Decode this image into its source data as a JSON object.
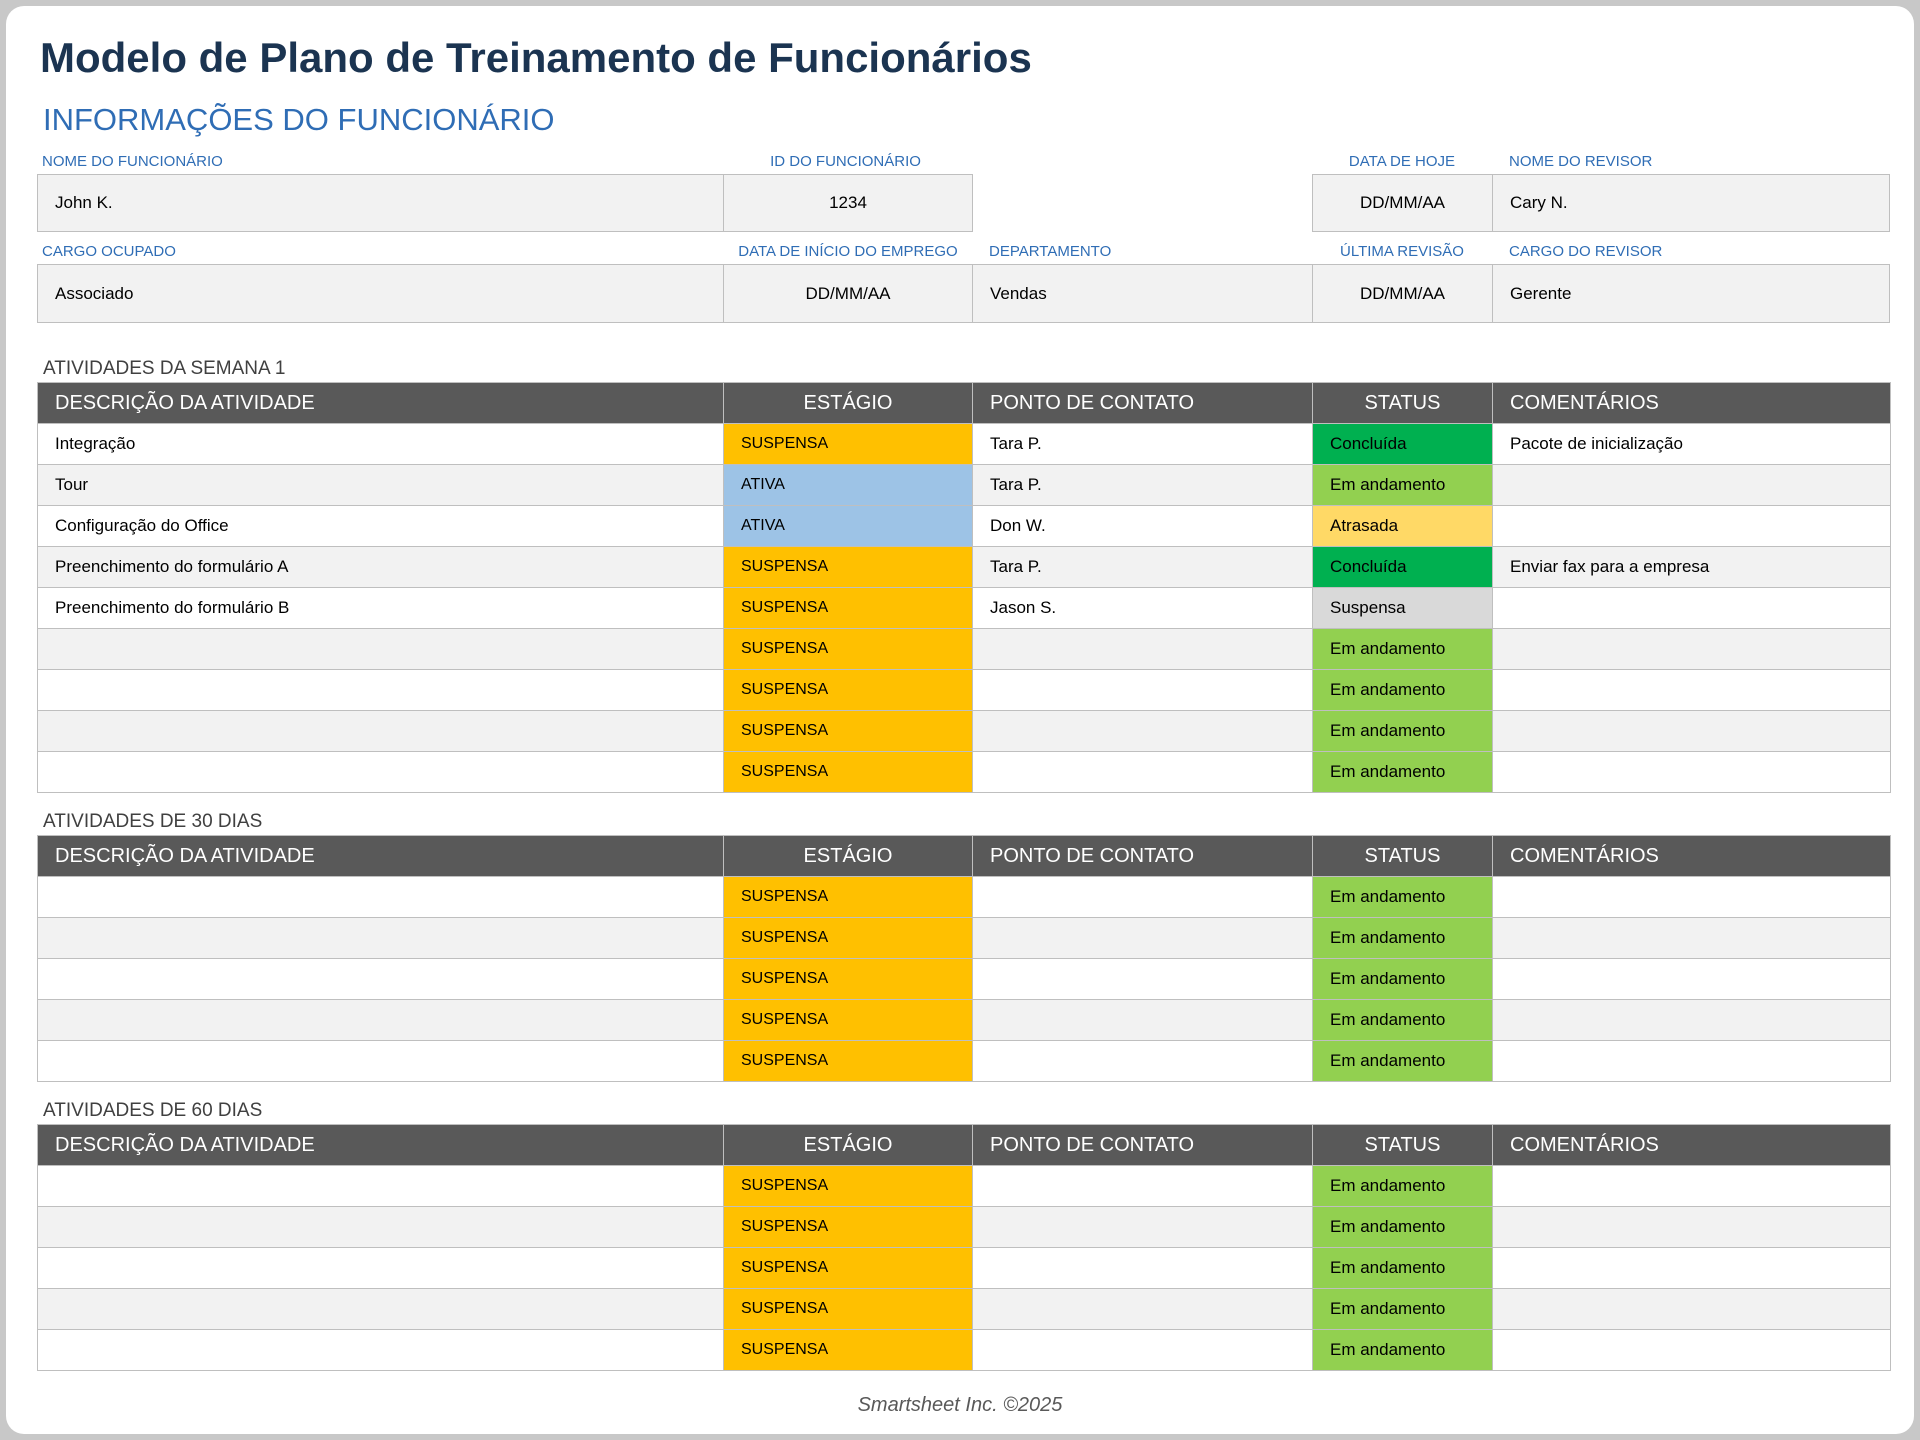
{
  "title": "Modelo de Plano de Treinamento de Funcionários",
  "info_heading": "INFORMAÇÕES DO FUNCIONÁRIO",
  "info": {
    "employee_name_label": "NOME DO FUNCIONÁRIO",
    "employee_name": "John K.",
    "employee_id_label": "ID DO FUNCIONÁRIO",
    "employee_id": "1234",
    "today_label": "DATA DE HOJE",
    "today": "DD/MM/AA",
    "reviewer_name_label": "NOME DO REVISOR",
    "reviewer_name": "Cary N.",
    "position_label": "CARGO OCUPADO",
    "position": "Associado",
    "start_date_label": "DATA DE INÍCIO DO EMPREGO",
    "start_date": "DD/MM/AA",
    "department_label": "DEPARTAMENTO",
    "department": "Vendas",
    "last_review_label": "ÚLTIMA REVISÃO",
    "last_review": "DD/MM/AA",
    "reviewer_position_label": "CARGO DO REVISOR",
    "reviewer_position": "Gerente"
  },
  "columns": {
    "description": "DESCRIÇÃO DA ATIVIDADE",
    "stage": "ESTÁGIO",
    "contact": "PONTO DE CONTATO",
    "status": "STATUS",
    "comments": "COMENTÁRIOS"
  },
  "colors": {
    "stage_suspensa": "#ffc000",
    "stage_ativa": "#9dc3e6",
    "status_em_andamento": "#92d050",
    "status_concluida": "#00b050",
    "status_atrasada": "#ffd966",
    "status_suspensa": "#d9d9d9",
    "header_bg": "#595959",
    "title_color": "#1b3451",
    "accent_blue": "#2f6db5"
  },
  "tables": [
    {
      "title": "ATIVIDADES DA SEMANA 1",
      "rows": [
        {
          "description": "Integração",
          "stage": "SUSPENSA",
          "contact": "Tara P.",
          "status": "Concluída",
          "comments": "Pacote de inicialização"
        },
        {
          "description": "Tour",
          "stage": "ATIVA",
          "contact": "Tara P.",
          "status": "Em andamento",
          "comments": ""
        },
        {
          "description": "Configuração do Office",
          "stage": "ATIVA",
          "contact": "Don W.",
          "status": "Atrasada",
          "comments": ""
        },
        {
          "description": "Preenchimento do formulário A",
          "stage": "SUSPENSA",
          "contact": "Tara P.",
          "status": "Concluída",
          "comments": "Enviar fax para a empresa"
        },
        {
          "description": "Preenchimento do formulário B",
          "stage": "SUSPENSA",
          "contact": "Jason S.",
          "status": "Suspensa",
          "comments": ""
        },
        {
          "description": "",
          "stage": "SUSPENSA",
          "contact": "",
          "status": "Em andamento",
          "comments": ""
        },
        {
          "description": "",
          "stage": "SUSPENSA",
          "contact": "",
          "status": "Em andamento",
          "comments": ""
        },
        {
          "description": "",
          "stage": "SUSPENSA",
          "contact": "",
          "status": "Em andamento",
          "comments": ""
        },
        {
          "description": "",
          "stage": "SUSPENSA",
          "contact": "",
          "status": "Em andamento",
          "comments": ""
        }
      ]
    },
    {
      "title": "ATIVIDADES DE 30 DIAS",
      "rows": [
        {
          "description": "",
          "stage": "SUSPENSA",
          "contact": "",
          "status": "Em andamento",
          "comments": ""
        },
        {
          "description": "",
          "stage": "SUSPENSA",
          "contact": "",
          "status": "Em andamento",
          "comments": ""
        },
        {
          "description": "",
          "stage": "SUSPENSA",
          "contact": "",
          "status": "Em andamento",
          "comments": ""
        },
        {
          "description": "",
          "stage": "SUSPENSA",
          "contact": "",
          "status": "Em andamento",
          "comments": ""
        },
        {
          "description": "",
          "stage": "SUSPENSA",
          "contact": "",
          "status": "Em andamento",
          "comments": ""
        }
      ]
    },
    {
      "title": "ATIVIDADES DE 60 DIAS",
      "rows": [
        {
          "description": "",
          "stage": "SUSPENSA",
          "contact": "",
          "status": "Em andamento",
          "comments": ""
        },
        {
          "description": "",
          "stage": "SUSPENSA",
          "contact": "",
          "status": "Em andamento",
          "comments": ""
        },
        {
          "description": "",
          "stage": "SUSPENSA",
          "contact": "",
          "status": "Em andamento",
          "comments": ""
        },
        {
          "description": "",
          "stage": "SUSPENSA",
          "contact": "",
          "status": "Em andamento",
          "comments": ""
        },
        {
          "description": "",
          "stage": "SUSPENSA",
          "contact": "",
          "status": "Em andamento",
          "comments": ""
        }
      ]
    }
  ],
  "footer": "Smartsheet Inc. ©2025"
}
